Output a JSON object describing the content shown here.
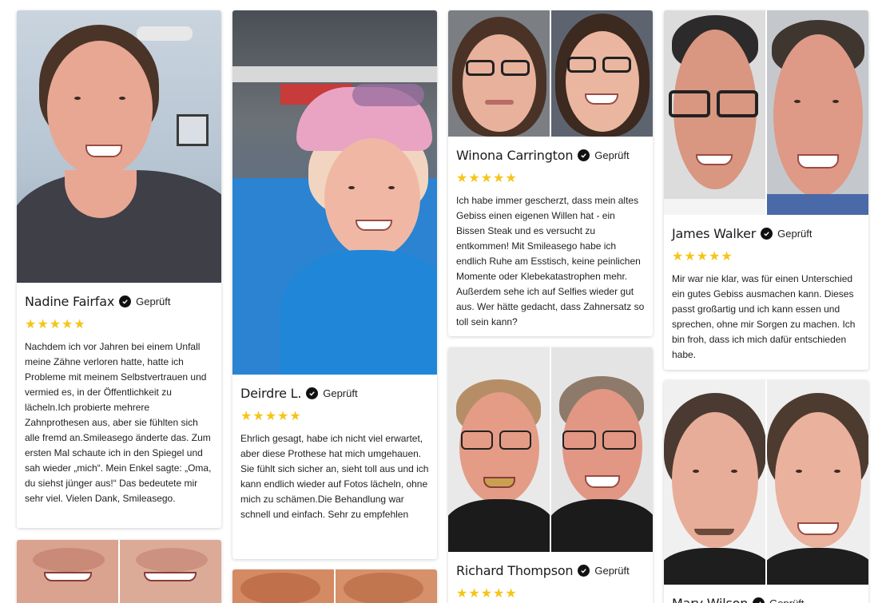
{
  "verified_label": "Geprüft",
  "stars": "★★★★★",
  "reviews": [
    {
      "name": "Nadine Fairfax",
      "text": "Nachdem ich vor Jahren bei einem Unfall meine Zähne verloren hatte, hatte ich Probleme mit meinem Selbstvertrauen und vermied es, in der Öffentlichkeit zu lächeln.Ich probierte mehrere Zahnprothesen aus, aber sie fühlten sich alle fremd an.Smileasego änderte das. Zum ersten Mal schaute ich in den Spiegel und sah wieder „mich“. Mein Enkel sagte: „Oma, du siehst jünger aus!“ Das bedeutete mir sehr viel. Vielen Dank, Smileasego."
    },
    {
      "name": "Deirdre L.",
      "text": "Ehrlich gesagt, habe ich nicht viel erwartet, aber diese Prothese hat mich umgehauen. Sie fühlt sich sicher an, sieht toll aus und ich kann endlich wieder auf Fotos lächeln, ohne mich zu schämen.Die Behandlung war schnell und einfach. Sehr zu empfehlen"
    },
    {
      "name": "Winona Carrington",
      "text": "Ich habe immer gescherzt, dass mein altes Gebiss einen eigenen Willen hat - ein Bissen Steak und es versucht zu entkommen! Mit Smileasego habe ich endlich Ruhe am Esstisch, keine peinlichen Momente oder Klebekatastrophen mehr. Außerdem sehe ich auf Selfies wieder gut aus. Wer hätte gedacht, dass Zahnersatz so toll sein kann?"
    },
    {
      "name": "Richard Thompson",
      "text": ""
    },
    {
      "name": "James Walker",
      "text": "Mir war nie klar, was für einen Unterschied ein gutes Gebiss ausmachen kann. Dieses passt großartig und ich kann essen und sprechen, ohne mir Sorgen zu machen. Ich bin froh, dass ich mich dafür entschieden habe."
    },
    {
      "name": "Mary Wilson",
      "text": ""
    }
  ]
}
